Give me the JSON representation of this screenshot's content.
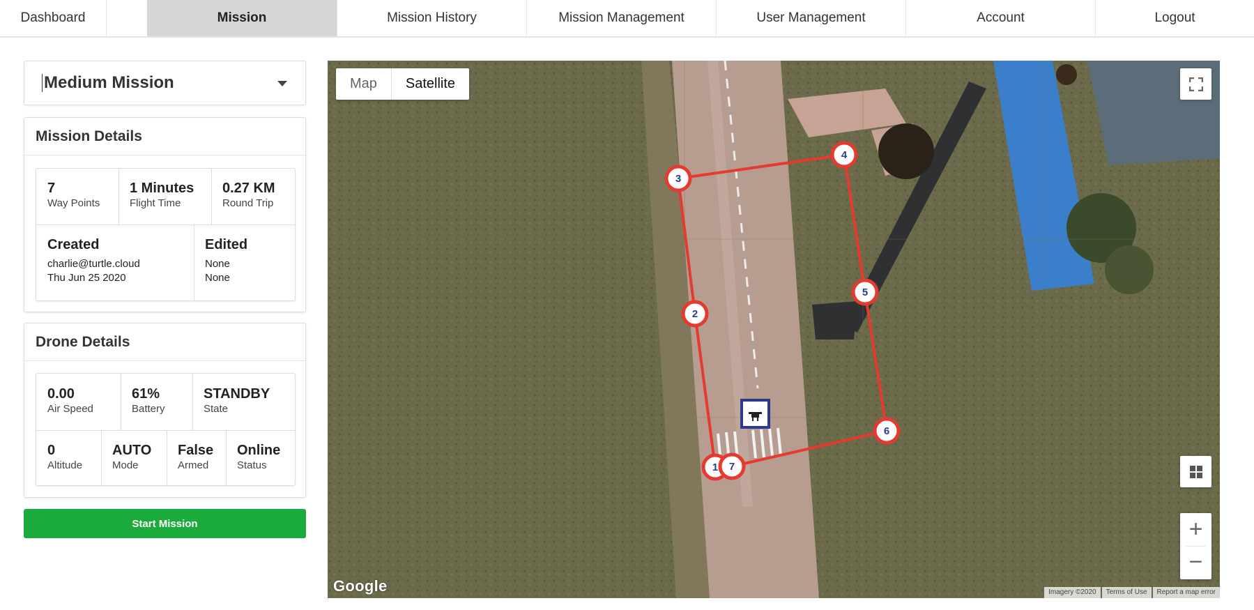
{
  "nav": {
    "items": [
      {
        "label": "Dashboard"
      },
      {
        "label": "Mission"
      },
      {
        "label": "Mission History"
      },
      {
        "label": "Mission Management"
      },
      {
        "label": "User Management"
      },
      {
        "label": "Account"
      },
      {
        "label": "Logout"
      }
    ],
    "active": "Mission"
  },
  "mission_select": {
    "value": "Medium Mission"
  },
  "mission_details": {
    "title": "Mission Details",
    "waypoints": {
      "value": "7",
      "label": "Way Points"
    },
    "flight_time": {
      "value": "1 Minutes",
      "label": "Flight Time"
    },
    "round_trip": {
      "value": "0.27 KM",
      "label": "Round Trip"
    },
    "created": {
      "label": "Created",
      "user": "charlie@turtle.cloud",
      "date": "Thu Jun 25 2020"
    },
    "edited": {
      "label": "Edited",
      "user": "None",
      "date": "None"
    }
  },
  "drone_details": {
    "title": "Drone Details",
    "air_speed": {
      "value": "0.00",
      "label": "Air Speed"
    },
    "battery": {
      "value": "61%",
      "label": "Battery"
    },
    "state": {
      "value": "STANDBY",
      "label": "State"
    },
    "altitude": {
      "value": "0",
      "label": "Altitude"
    },
    "mode": {
      "value": "AUTO",
      "label": "Mode"
    },
    "armed": {
      "value": "False",
      "label": "Armed"
    },
    "status": {
      "value": "Online",
      "label": "Status"
    }
  },
  "start_button": {
    "label": "Start Mission"
  },
  "map": {
    "type_options": [
      "Map",
      "Satellite"
    ],
    "selected_type": "Satellite",
    "waypoint_labels": [
      "1",
      "2",
      "3",
      "4",
      "5",
      "6",
      "7"
    ],
    "logo": "Google",
    "attribution": [
      "Imagery ©2020",
      "Terms of Use",
      "Report a map error"
    ],
    "route_color": "#e53a2f",
    "marker_border_color": "#2b3a8f",
    "zoom_in": "+",
    "zoom_out": "−"
  },
  "colors": {
    "accent_green": "#1aab3c",
    "active_tab": "#d6d6d6"
  }
}
